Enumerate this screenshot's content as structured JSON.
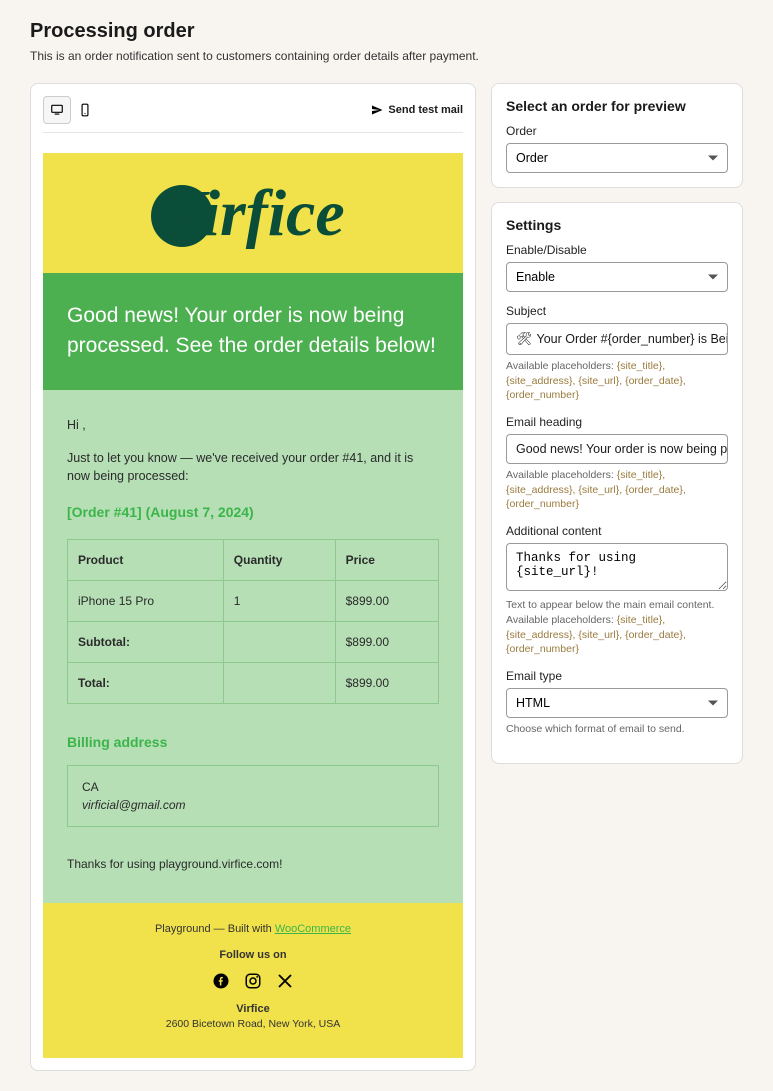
{
  "page": {
    "title": "Processing order",
    "description": "This is an order notification sent to customers containing order details after payment."
  },
  "toolbar": {
    "send_test_label": "Send test mail"
  },
  "email": {
    "logo_text": "Virfice",
    "heading": "Good news! Your order is now being processed. See the order details below!",
    "greeting": "Hi ,",
    "intro": "Just to let you know — we've received your order #41, and it is now being processed:",
    "order_link": "[Order #41] (August 7, 2024)",
    "table": {
      "headers": {
        "product": "Product",
        "quantity": "Quantity",
        "price": "Price"
      },
      "rows": [
        {
          "product": "iPhone 15 Pro",
          "quantity": "1",
          "price": "$899.00"
        }
      ],
      "subtotal_label": "Subtotal:",
      "subtotal_value": "$899.00",
      "total_label": "Total:",
      "total_value": "$899.00"
    },
    "billing": {
      "title": "Billing address",
      "region": "CA",
      "email": "virficial@gmail.com"
    },
    "thanks": "Thanks for using playground.virfice.com!",
    "footer": {
      "built_prefix": "Playground — Built with ",
      "built_link": "WooCommerce",
      "follow": "Follow us on",
      "brand": "Virfice",
      "address": "2600 Bicetown Road, New York, USA"
    }
  },
  "sidebar": {
    "preview": {
      "title": "Select an order for preview",
      "order_label": "Order",
      "order_value": "Order"
    },
    "settings": {
      "title": "Settings",
      "enable_label": "Enable/Disable",
      "enable_value": "Enable",
      "subject_label": "Subject",
      "subject_value": "Your Order #{order_number} is Being Proces",
      "placeholders_prefix": "Available placeholders: ",
      "placeholders_list": "{site_title}, {site_address}, {site_url}, {order_date}, {order_number}",
      "heading_label": "Email heading",
      "heading_value": "Good news! Your order is now being processed.",
      "additional_label": "Additional content",
      "additional_value": "Thanks for using {site_url}!",
      "additional_hint_prefix": "Text to appear below the main email content. Available placeholders: ",
      "emailtype_label": "Email type",
      "emailtype_value": "HTML",
      "emailtype_hint": "Choose which format of email to send."
    }
  }
}
